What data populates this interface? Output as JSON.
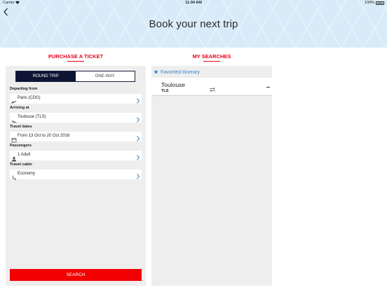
{
  "status_bar": {
    "carrier": "Carrier",
    "time": "11:04 AM",
    "battery": "100%"
  },
  "header": {
    "title": "Book your next trip"
  },
  "tabs": {
    "purchase": "PURCHASE A TICKET",
    "searches": "MY SEARCHES"
  },
  "trip_type": {
    "round_trip": "ROUND TRIP",
    "one_way": "ONE-WAY",
    "selected": "ROUND TRIP"
  },
  "form": {
    "departing_label": "Departing from",
    "departing_value": "Paris (CDG)",
    "arriving_label": "Arriving at",
    "arriving_value": "Toulouse (TLS)",
    "dates_label": "Travel dates",
    "dates_value": "From 13 Oct to 20 Oct 2016",
    "passengers_label": "Passengers",
    "passengers_value": "1 Adult",
    "cabin_label": "Travel cabin",
    "cabin_value": "Economy",
    "search_label": "SEARCH"
  },
  "searches": {
    "favorited_label": "Favorited itinerary",
    "items": [
      {
        "city": "Toulouse",
        "code": "TLS"
      }
    ]
  },
  "colors": {
    "accent_red": "#e8001c",
    "button_red": "#f20000",
    "navy": "#0e1433",
    "link_blue": "#3a86c9",
    "header_bg": "#d7ecf8"
  }
}
